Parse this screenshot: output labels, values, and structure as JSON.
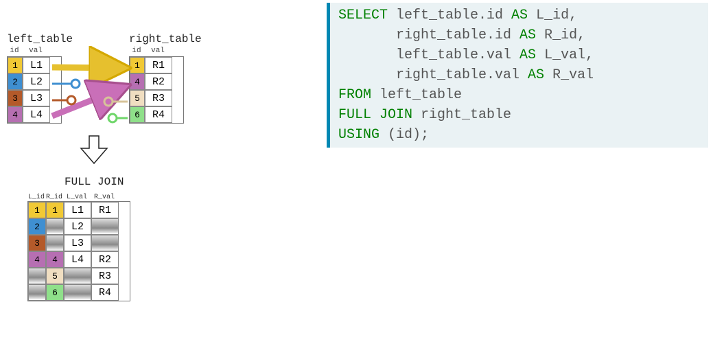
{
  "left_table": {
    "title": "left_table",
    "columns": [
      "id",
      "val"
    ],
    "rows": [
      {
        "id": "1",
        "val": "L1",
        "color": "#f1c935"
      },
      {
        "id": "2",
        "val": "L2",
        "color": "#3f8fd1"
      },
      {
        "id": "3",
        "val": "L3",
        "color": "#b45a2a"
      },
      {
        "id": "4",
        "val": "L4",
        "color": "#b66fb2"
      }
    ]
  },
  "right_table": {
    "title": "right_table",
    "columns": [
      "id",
      "val"
    ],
    "rows": [
      {
        "id": "1",
        "val": "R1",
        "color": "#f1c935"
      },
      {
        "id": "4",
        "val": "R2",
        "color": "#b66fb2"
      },
      {
        "id": "5",
        "val": "R3",
        "color": "#f0dec1"
      },
      {
        "id": "6",
        "val": "R4",
        "color": "#8fe08a"
      }
    ]
  },
  "join_label": "FULL JOIN",
  "result_table": {
    "columns": [
      "L_id",
      "R_id",
      "L_val",
      "R_val"
    ],
    "rows": [
      {
        "L_id": "1",
        "R_id": "1",
        "L_val": "L1",
        "R_val": "R1",
        "L_color": "#f1c935",
        "R_color": "#f1c935"
      },
      {
        "L_id": "2",
        "R_id": null,
        "L_val": "L2",
        "R_val": null,
        "L_color": "#3f8fd1",
        "R_color": null
      },
      {
        "L_id": "3",
        "R_id": null,
        "L_val": "L3",
        "R_val": null,
        "L_color": "#b45a2a",
        "R_color": null
      },
      {
        "L_id": "4",
        "R_id": "4",
        "L_val": "L4",
        "R_val": "R2",
        "L_color": "#b66fb2",
        "R_color": "#b66fb2"
      },
      {
        "L_id": null,
        "R_id": "5",
        "L_val": null,
        "R_val": "R3",
        "L_color": null,
        "R_color": "#f0dec1"
      },
      {
        "L_id": null,
        "R_id": "6",
        "L_val": null,
        "R_val": "R4",
        "L_color": null,
        "R_color": "#8fe08a"
      }
    ]
  },
  "sql": {
    "line1a": "SELECT",
    "line1b": " left_table.id ",
    "line1c": "AS",
    "line1d": " L_id,",
    "line2": "       right_table.id ",
    "line2b": "AS",
    "line2c": " R_id,",
    "line3": "       left_table.val ",
    "line3b": "AS",
    "line3c": " L_val,",
    "line4": "       right_table.val ",
    "line4b": "AS",
    "line4c": " R_val",
    "line5a": "FROM",
    "line5b": " left_table",
    "line6a": "FULL JOIN",
    "line6b": " right_table",
    "line7a": "USING",
    "line7b": " (id);"
  }
}
